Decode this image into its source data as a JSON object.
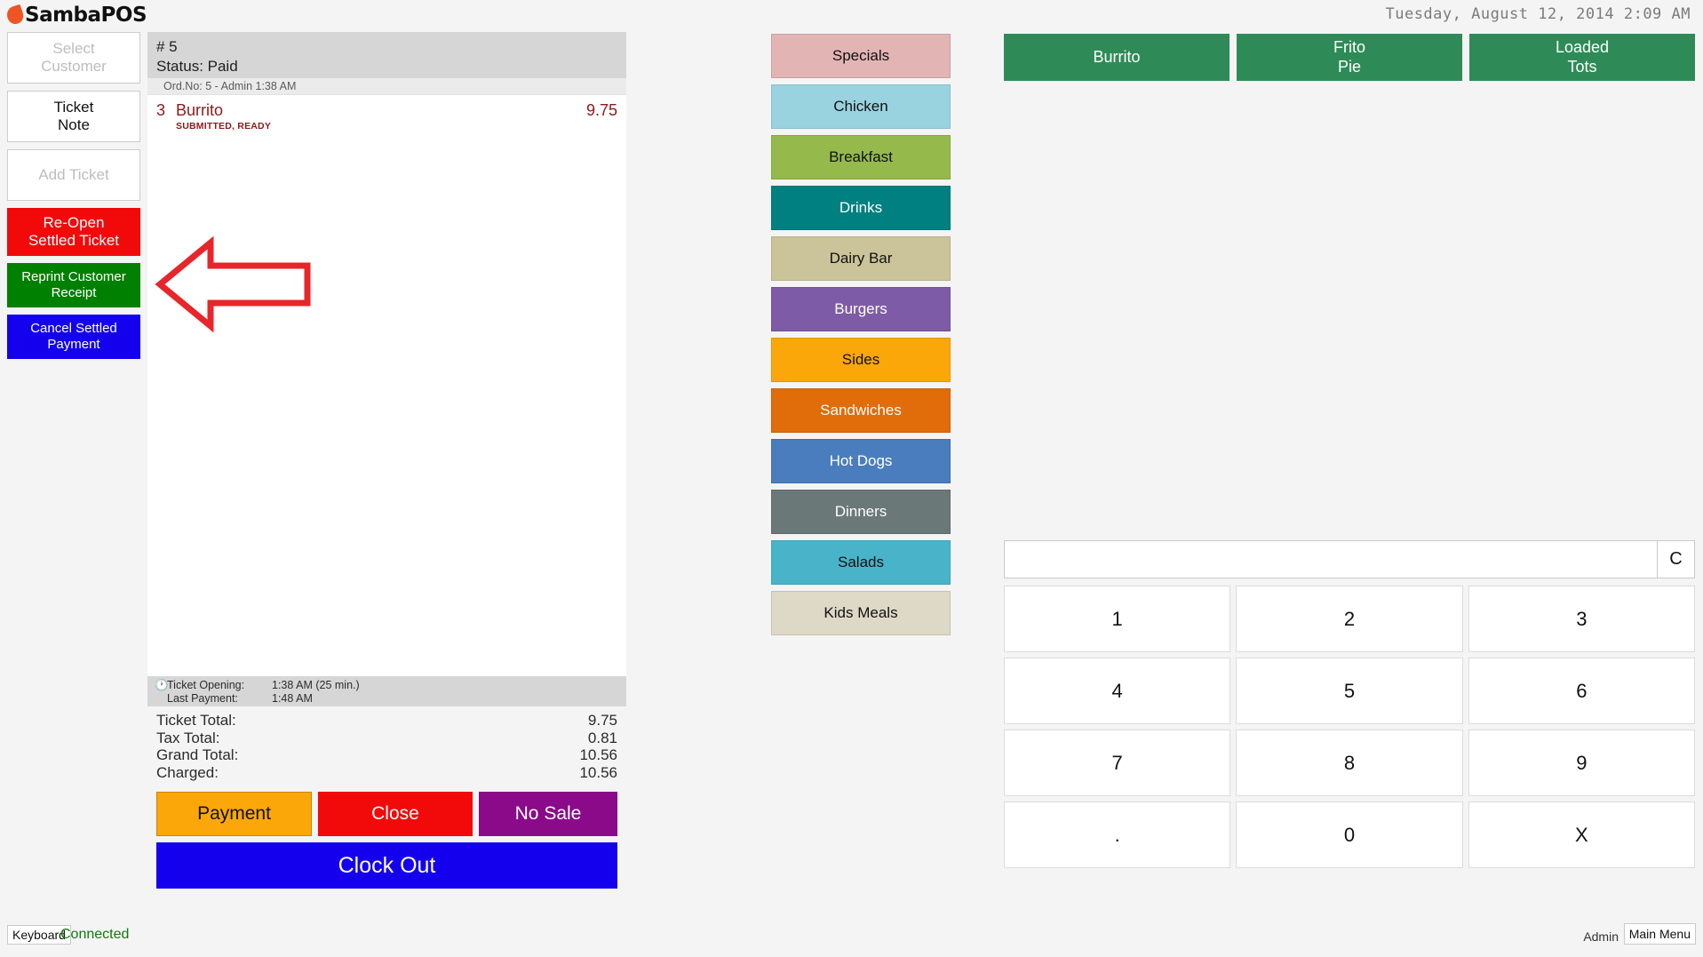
{
  "app": {
    "brand": "SambaPOS",
    "datetime": "Tuesday, August 12, 2014 2:09 AM"
  },
  "commands": [
    {
      "label": "Select\nCustomer",
      "style": "disabled"
    },
    {
      "label": "Ticket\nNote",
      "style": "normal"
    },
    {
      "label": "Add Ticket",
      "style": "disabled"
    },
    {
      "label": "Re-Open\nSettled Ticket",
      "style": "red"
    },
    {
      "label": "Reprint Customer Receipt",
      "style": "green"
    },
    {
      "label": "Cancel Settled Payment",
      "style": "blue"
    }
  ],
  "ticket": {
    "number": "# 5",
    "status": "Status: Paid",
    "order_info": "Ord.No: 5 - Admin  1:38 AM",
    "orders": [
      {
        "qty": "3",
        "name": "Burrito",
        "state": "SUBMITTED, READY",
        "price": "9.75"
      }
    ],
    "opening_label": "Ticket Opening:",
    "opening_value": "1:38 AM (25 min.)",
    "lastpay_label": "Last Payment:",
    "lastpay_value": "1:48 AM",
    "totals": [
      {
        "label": "Ticket Total:",
        "value": "9.75"
      },
      {
        "label": "Tax Total:",
        "value": "0.81"
      },
      {
        "label": "Grand Total:",
        "value": "10.56"
      },
      {
        "label": "Charged:",
        "value": "10.56"
      }
    ],
    "actions": {
      "payment": "Payment",
      "close": "Close",
      "nosale": "No Sale",
      "clockout": "Clock Out"
    }
  },
  "categories": [
    {
      "label": "Specials",
      "bg": "#e3b4b4",
      "fg": "#111111"
    },
    {
      "label": "Chicken",
      "bg": "#9ad3e0",
      "fg": "#111111"
    },
    {
      "label": "Breakfast",
      "bg": "#96b94b",
      "fg": "#111111"
    },
    {
      "label": "Drinks",
      "bg": "#008080",
      "fg": "#ffffff"
    },
    {
      "label": "Dairy Bar",
      "bg": "#cbc49a",
      "fg": "#111111"
    },
    {
      "label": "Burgers",
      "bg": "#7e5ba6",
      "fg": "#ffffff"
    },
    {
      "label": "Sides",
      "bg": "#fba70a",
      "fg": "#111111"
    },
    {
      "label": "Sandwiches",
      "bg": "#e06c0a",
      "fg": "#ffffff"
    },
    {
      "label": "Hot Dogs",
      "bg": "#4a7dbd",
      "fg": "#ffffff"
    },
    {
      "label": "Dinners",
      "bg": "#6b7878",
      "fg": "#ffffff"
    },
    {
      "label": "Salads",
      "bg": "#49b4c9",
      "fg": "#111111"
    },
    {
      "label": "Kids Meals",
      "bg": "#ded9c6",
      "fg": "#111111"
    }
  ],
  "products": [
    {
      "label": "Burrito"
    },
    {
      "label": "Frito\nPie"
    },
    {
      "label": "Loaded\nTots"
    }
  ],
  "numpad": {
    "display_value": "",
    "clear_label": "C",
    "keys": [
      "1",
      "2",
      "3",
      "4",
      "5",
      "6",
      "7",
      "8",
      "9",
      ".",
      "0",
      "X"
    ]
  },
  "statusbar": {
    "keyboard": "Keyboard",
    "connected": "Connected",
    "admin": "Admin",
    "main_menu": "Main Menu"
  },
  "annotation": {
    "type": "arrow-left",
    "color": "#e8252a"
  }
}
